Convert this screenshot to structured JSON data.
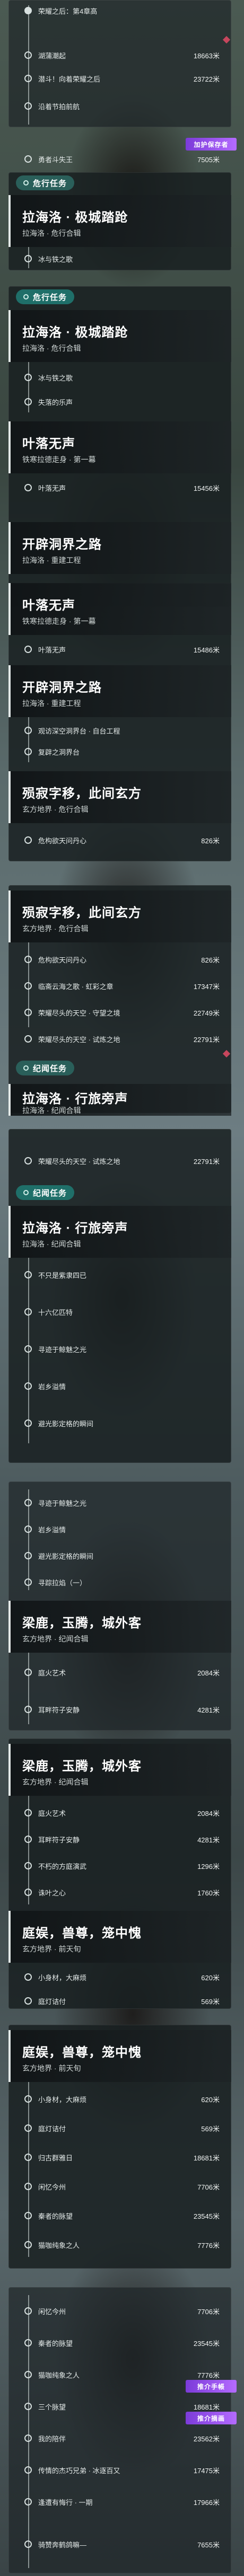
{
  "top": {
    "rows": [
      {
        "label": "荣耀之后：第4章高",
        "dist": ""
      },
      {
        "label": "湖蒲潮起",
        "dist": "18663米"
      },
      {
        "label": "潜斗！向着荣耀之后",
        "dist": "23722米"
      },
      {
        "label": "沿着节拍前航",
        "dist": ""
      },
      {
        "label": "勇者斗失王",
        "dist": "7505米"
      }
    ],
    "badge": "加护保存者"
  },
  "s1": {
    "header": "危行任务",
    "card": {
      "title": "拉海洛 · 极城踏跄",
      "sub": "拉海洛 · 危行合辑"
    },
    "rows": [
      {
        "label": "冰与铁之歌",
        "dist": ""
      }
    ]
  },
  "s2": {
    "header": "危行任务",
    "card1": {
      "title": "拉海洛 · 极城踏跄",
      "sub": "拉海洛 · 危行合辑"
    },
    "rows_a": [
      {
        "label": "冰与铁之歌",
        "dist": ""
      },
      {
        "label": "失落的乐声",
        "dist": ""
      }
    ],
    "card2": {
      "title": "叶落无声",
      "sub": "铁寒拉德走身 · 第一幕"
    },
    "rows_b": [
      {
        "label": "叶落无声",
        "dist": "15456米"
      }
    ],
    "card3": {
      "title": "开辟洞界之路",
      "sub": "拉海洛 · 重建工程"
    }
  },
  "s3": {
    "card1": {
      "title": "叶落无声",
      "sub": "铁寒拉德走身 · 第一幕"
    },
    "rows_a": [
      {
        "label": "叶落无声",
        "dist": "15486米"
      }
    ],
    "card2": {
      "title": "开辟洞界之路",
      "sub": "拉海洛 · 重建工程"
    },
    "rows_b": [
      {
        "label": "观访深空洞界台 · 自台工程",
        "dist": ""
      },
      {
        "label": "复辟之洞界台",
        "dist": ""
      }
    ],
    "card3": {
      "title": "殒寂字移，此间玄方",
      "sub": "玄方地界 · 危行合辑"
    },
    "rows_c": [
      {
        "label": "危构欲天问丹心",
        "dist": "826米"
      }
    ]
  },
  "s4": {
    "card1": {
      "title": "殒寂字移，此间玄方",
      "sub": "玄方地界 · 危行合辑"
    },
    "rows": [
      {
        "label": "危构欲天问丹心",
        "dist": "826米"
      },
      {
        "label": "临斋云海之歌 · 虹彩之章",
        "dist": "17347米"
      },
      {
        "label": "荣耀尽头的天空 · 守望之境",
        "dist": "22749米"
      },
      {
        "label": "荣耀尽头的天空 · 试炼之地",
        "dist": "22791米"
      }
    ],
    "header2": "纪闻任务",
    "card2": {
      "title": "拉海洛 · 行旅旁声",
      "sub": "拉海洛 · 纪闻合辑"
    }
  },
  "s5": {
    "rows": [
      {
        "label": "荣耀尽头的天空 · 试炼之地",
        "dist": "22791米"
      }
    ],
    "header": "纪闻任务",
    "card1": {
      "title": "拉海洛 · 行旅旁声",
      "sub": "拉海洛 · 纪闻合辑"
    },
    "rows_a": [
      {
        "label": "不只是紫隶四已",
        "dist": ""
      },
      {
        "label": "十六亿匹特",
        "dist": ""
      },
      {
        "label": "寻迹于鲸魅之光",
        "dist": ""
      },
      {
        "label": "岩乡溢情",
        "dist": ""
      },
      {
        "label": "避光影定格的瞬间",
        "dist": ""
      }
    ]
  },
  "s6": {
    "rows_a": [
      {
        "label": "寻迹于鲸魅之光",
        "dist": ""
      },
      {
        "label": "岩乡溢情",
        "dist": ""
      },
      {
        "label": "避光影定格的瞬间",
        "dist": ""
      },
      {
        "label": "寻踪拉焰（一）",
        "dist": ""
      }
    ],
    "card1": {
      "title": "梁鹿，玉腾，城外客",
      "sub": "玄方地界 · 纪闻合辑"
    },
    "rows_b": [
      {
        "label": "庭火艺术",
        "dist": "2084米"
      },
      {
        "label": "耳畔符子安静",
        "dist": "4281米"
      }
    ]
  },
  "s7": {
    "card1": {
      "title": "梁鹿，玉腾，城外客",
      "sub": "玄方地界 · 纪闻合辑"
    },
    "rows_a": [
      {
        "label": "庭火艺术",
        "dist": "2084米"
      },
      {
        "label": "耳畔符子安静",
        "dist": "4281米"
      },
      {
        "label": "不朽的方庭演武",
        "dist": "1296米"
      },
      {
        "label": "诛叶之心",
        "dist": "1760米"
      }
    ],
    "card2": {
      "title": "庭娱，兽尊，笼中愧",
      "sub": "玄方地界 · 前天旬"
    },
    "rows_b": [
      {
        "label": "小身材，大麻烦",
        "dist": "620米"
      },
      {
        "label": "庭灯诘付",
        "dist": "569米"
      }
    ]
  },
  "s8": {
    "card1": {
      "title": "庭娱，兽尊，笼中愧",
      "sub": "玄方地界 · 前天旬"
    },
    "rows_a": [
      {
        "label": "小身材，大麻烦",
        "dist": "620米"
      },
      {
        "label": "庭灯诘付",
        "dist": "569米"
      },
      {
        "label": "归古群雅日",
        "dist": "18681米"
      },
      {
        "label": "闲忆今州",
        "dist": "7706米"
      },
      {
        "label": "秦者的脉望",
        "dist": "23545米"
      },
      {
        "label": "猫咖纯象之人",
        "dist": "7776米"
      }
    ]
  },
  "s9": {
    "rows_a": [
      {
        "label": "闲忆今州",
        "dist": "7706米"
      },
      {
        "label": "秦者的脉望",
        "dist": "23545米"
      },
      {
        "label": "猫咖纯象之人",
        "dist": "7776米"
      },
      {
        "label": "三个脉望",
        "dist": "18681米"
      },
      {
        "label": "我的陪伴",
        "dist": "23562米"
      },
      {
        "label": "传情的杰巧兄弟 · 冰逐百又",
        "dist": "17475米"
      },
      {
        "label": "逢遭有悔行 · 一期",
        "dist": "17966米"
      },
      {
        "label": "骑赞奔鹤鸽嘛—",
        "dist": "7655米"
      }
    ],
    "badge1": "推介手帳",
    "badge2": "推介摘画"
  }
}
